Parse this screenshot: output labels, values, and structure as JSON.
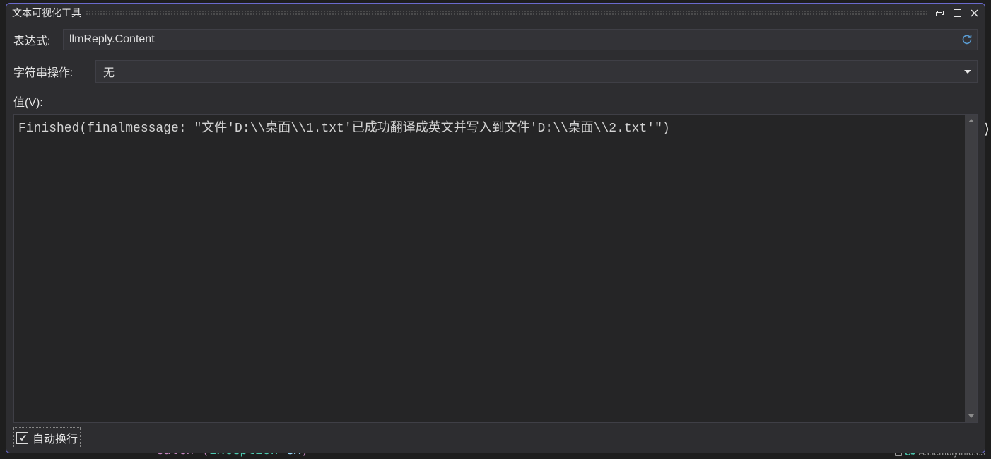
{
  "dialog": {
    "title": "文本可视化工具",
    "expression_label": "表达式:",
    "expression_value": "llmReply.Content",
    "string_ops_label": "字符串操作:",
    "string_ops_selected": "无",
    "value_label": "值(V):",
    "value_text": "Finished(finalmessage: \"文件'D:\\\\桌面\\\\1.txt'已成功翻译成英文并写入到文件'D:\\\\桌面\\\\2.txt'\")",
    "wrap_label": "自动换行",
    "wrap_checked": true
  },
  "background": {
    "code_fragment_catch": "catch",
    "code_fragment_type": "Exception",
    "code_fragment_var": "ex",
    "assembly_name": "AssemblyInfo.cs"
  }
}
